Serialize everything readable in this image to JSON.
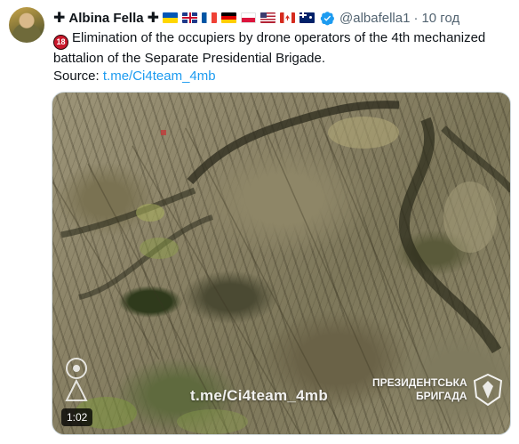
{
  "author": {
    "prefix_symbol": "✚",
    "name": "Albina Fella",
    "suffix_symbol": "✚",
    "flags": [
      "ukraine-flag",
      "uk-flag",
      "france-flag",
      "germany-flag",
      "poland-flag",
      "usa-flag",
      "canada-flag",
      "australia-flag"
    ],
    "verified": true,
    "handle": "@albafella1",
    "separator": "·",
    "time": "10 год"
  },
  "tweet": {
    "age_badge": "18",
    "text": "Elimination of the occupiers by drone operators of the 4th mechanized battalion of the Separate Presidential Brigade.",
    "source_label": "Source:",
    "source_link": "t.me/Ci4team_4mb"
  },
  "media": {
    "watermark_url": "t.me/Ci4team_4mb",
    "brigade_line1": "ПРЕЗИДЕНТСЬКА",
    "brigade_line2": "БРИГАДА",
    "duration": "1:02"
  },
  "colors": {
    "link": "#1d9bf0",
    "verified": "#1d9bf0",
    "muted": "#536471",
    "age_badge": "#c9182b"
  }
}
